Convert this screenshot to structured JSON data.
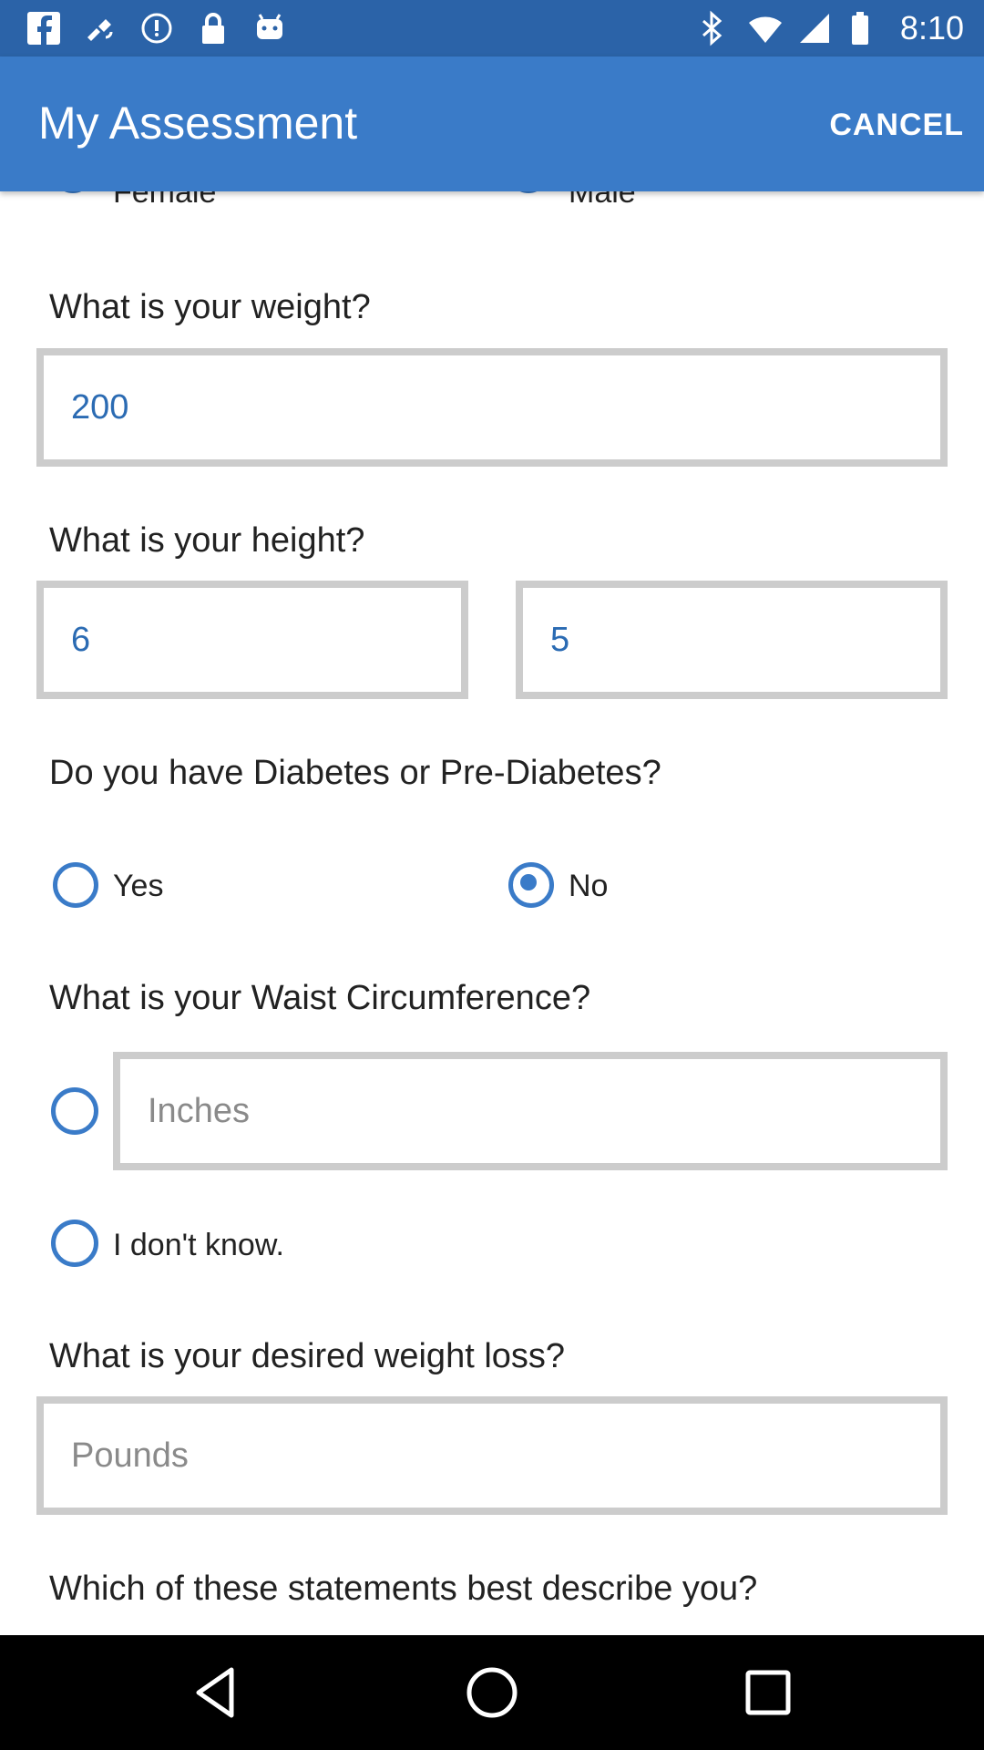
{
  "status_bar": {
    "time": "8:10",
    "left_icons": [
      "facebook-icon",
      "fake-gps-icon",
      "alarm-icon",
      "lock-icon",
      "android-icon"
    ],
    "right_icons": [
      "bluetooth-icon",
      "wifi-icon",
      "signal-icon",
      "battery-icon"
    ]
  },
  "app_bar": {
    "title": "My Assessment",
    "cancel_label": "CANCEL"
  },
  "gender": {
    "female_label": "Female",
    "male_label": "Male",
    "selected": "Male"
  },
  "weight": {
    "question": "What is your weight?",
    "value": "200"
  },
  "height": {
    "question": "What is your height?",
    "feet": "6",
    "inches": "5"
  },
  "diabetes": {
    "question": "Do you have Diabetes or Pre-Diabetes?",
    "yes_label": "Yes",
    "no_label": "No",
    "selected": "No"
  },
  "waist": {
    "question": "What is your Waist Circumference?",
    "placeholder": "Inches",
    "dont_know_label": "I don't know."
  },
  "weight_loss": {
    "question": "What is your desired weight loss?",
    "placeholder": "Pounds"
  },
  "statements": {
    "question": "Which of these statements best describe you?"
  },
  "colors": {
    "primary": "#3a7bc8",
    "status_bar": "#2b63a8",
    "field_border": "#cccccc",
    "value_text": "#2b6bb3"
  }
}
